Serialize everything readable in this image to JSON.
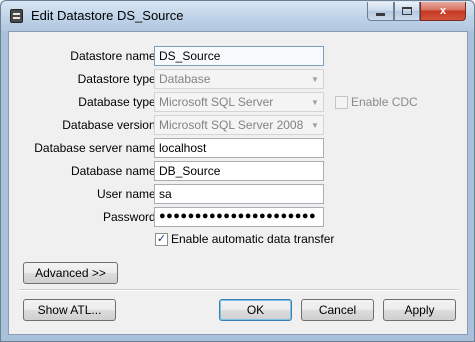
{
  "window": {
    "title": "Edit Datastore DS_Source",
    "app_icon": "datastore-icon",
    "controls": {
      "minimize": "minimize-icon",
      "maximize": "maximize-icon",
      "close_glyph": "x"
    }
  },
  "form": {
    "datastore_name": {
      "label": "Datastore name:",
      "value": "DS_Source"
    },
    "datastore_type": {
      "label": "Datastore type:",
      "value": "Database"
    },
    "database_type": {
      "label": "Database type:",
      "value": "Microsoft SQL Server"
    },
    "enable_cdc": {
      "label": "Enable CDC",
      "checked": false
    },
    "database_version": {
      "label": "Database version:",
      "value": "Microsoft SQL Server 2008"
    },
    "database_server_name": {
      "label": "Database server name:",
      "value": "localhost"
    },
    "database_name": {
      "label": "Database name:",
      "value": "DB_Source"
    },
    "user_name": {
      "label": "User name:",
      "value": "sa"
    },
    "password": {
      "label": "Password:",
      "value": "●●●●●●●●●●●●●●●●●●●●●●"
    },
    "auto_transfer": {
      "label": "Enable automatic data transfer",
      "checked": true,
      "check_glyph": "✓"
    }
  },
  "buttons": {
    "advanced": "Advanced >>",
    "show_atl": "Show ATL...",
    "ok": "OK",
    "cancel": "Cancel",
    "apply": "Apply"
  },
  "icons": {
    "dropdown_arrow": "▼"
  }
}
